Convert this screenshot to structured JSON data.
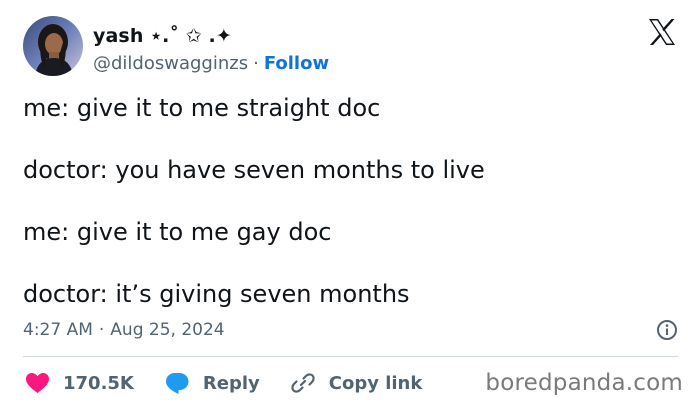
{
  "user": {
    "display_name": "yash ⋆.˚ ✩ .✦",
    "handle": "@dildoswagginzs",
    "separator": "·",
    "follow_label": "Follow",
    "avatar_icon": "profile-photo"
  },
  "brand": {
    "logo_icon": "x-logo-icon"
  },
  "tweet": {
    "lines": [
      "me: give it to me straight doc",
      "doctor: you have seven months to live",
      "me: give it to me gay doc",
      "doctor: it’s giving seven months"
    ],
    "time": "4:27 AM",
    "separator": "·",
    "date": "Aug 25, 2024"
  },
  "actions": {
    "like_count": "170.5K",
    "reply_label": "Reply",
    "copy_link_label": "Copy link"
  },
  "watermark": "boredpanda.com",
  "colors": {
    "text": "#0f1419",
    "secondary": "#536471",
    "follow": "#0f73d8",
    "like": "#f91880",
    "reply": "#1d9bf0",
    "divider": "#cfd9de"
  }
}
